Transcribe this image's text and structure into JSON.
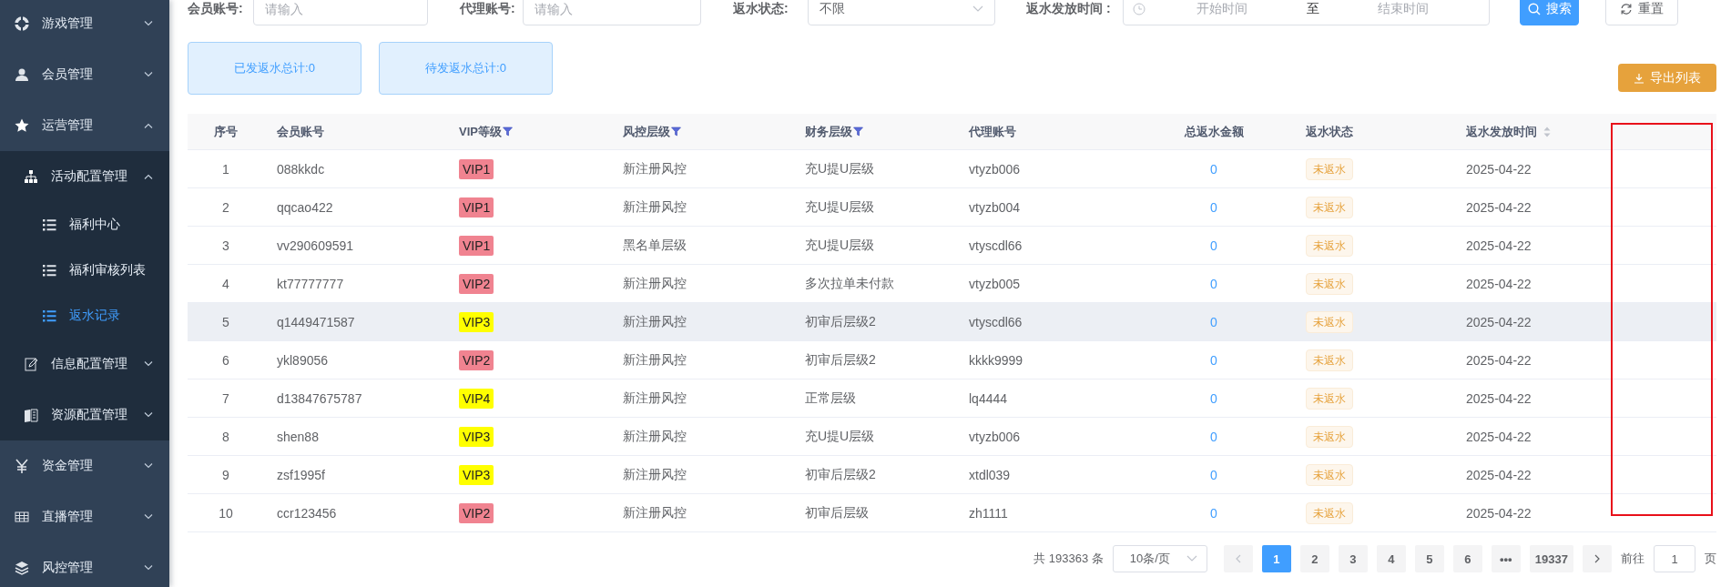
{
  "sidebar": {
    "items": [
      {
        "label": "游戏管理",
        "expanded": false,
        "selected": false
      },
      {
        "label": "会员管理",
        "expanded": false,
        "selected": false
      },
      {
        "label": "运营管理",
        "expanded": true,
        "selected": false,
        "children": [
          {
            "label": "活动配置管理",
            "expanded": true,
            "selected": false,
            "children": [
              {
                "label": "福利中心",
                "selected": false
              },
              {
                "label": "福利审核列表",
                "selected": false
              },
              {
                "label": "返水记录",
                "selected": true
              }
            ]
          },
          {
            "label": "信息配置管理",
            "expanded": false,
            "selected": false
          },
          {
            "label": "资源配置管理",
            "expanded": false,
            "selected": false
          }
        ]
      },
      {
        "label": "资金管理",
        "expanded": false,
        "selected": false
      },
      {
        "label": "直播管理",
        "expanded": false,
        "selected": false
      },
      {
        "label": "风控管理",
        "expanded": false,
        "selected": false
      }
    ]
  },
  "filters": [
    {
      "kind": "input",
      "label": "会员账号:",
      "placeholder": "请输入"
    },
    {
      "kind": "input",
      "label": "代理账号:",
      "placeholder": "请输入"
    },
    {
      "kind": "select",
      "label": "返水状态:",
      "value": "不限"
    },
    {
      "kind": "daterange",
      "label": "返水发放时间 :",
      "start_placeholder": "开始时间",
      "separator": "至",
      "end_placeholder": "结束时间"
    }
  ],
  "search_button": "搜索",
  "reset_button": "重置",
  "summary_cards": [
    "已发返水总计:0",
    "待发返水总计:0"
  ],
  "export_button": "导出列表",
  "table": {
    "columns": [
      {
        "label": "序号",
        "kind": "plain"
      },
      {
        "label": "会员账号",
        "kind": "plain"
      },
      {
        "label": "VIP等级",
        "kind": "filter"
      },
      {
        "label": "风控层级",
        "kind": "filter"
      },
      {
        "label": "财务层级",
        "kind": "filter"
      },
      {
        "label": "代理账号",
        "kind": "plain"
      },
      {
        "label": "总返水金额",
        "kind": "plain"
      },
      {
        "label": "返水状态",
        "kind": "plain"
      },
      {
        "label": "返水发放时间",
        "kind": "sortable"
      }
    ],
    "rows": [
      {
        "index": "1",
        "account": "088kkdc",
        "vip": {
          "label": "VIP1",
          "color": "#f08390"
        },
        "risk": "新注册风控",
        "finance": "充U提U层级",
        "agent": "vtyzb006",
        "total": "0",
        "status": "未返水",
        "time": "2025-04-22",
        "hovered": false
      },
      {
        "index": "2",
        "account": "qqcao422",
        "vip": {
          "label": "VIP1",
          "color": "#f08390"
        },
        "risk": "新注册风控",
        "finance": "充U提U层级",
        "agent": "vtyzb004",
        "total": "0",
        "status": "未返水",
        "time": "2025-04-22",
        "hovered": false
      },
      {
        "index": "3",
        "account": "vv290609591",
        "vip": {
          "label": "VIP1",
          "color": "#f08390"
        },
        "risk": "黑名单层级",
        "finance": "充U提U层级",
        "agent": "vtyscdl66",
        "total": "0",
        "status": "未返水",
        "time": "2025-04-22",
        "hovered": false
      },
      {
        "index": "4",
        "account": "kt77777777",
        "vip": {
          "label": "VIP2",
          "color": "#f08390"
        },
        "risk": "新注册风控",
        "finance": "多次拉单未付款",
        "agent": "vtyzb005",
        "total": "0",
        "status": "未返水",
        "time": "2025-04-22",
        "hovered": false
      },
      {
        "index": "5",
        "account": "q1449471587",
        "vip": {
          "label": "VIP3",
          "color": "#ffff00"
        },
        "risk": "新注册风控",
        "finance": "初审后层级2",
        "agent": "vtyscdl66",
        "total": "0",
        "status": "未返水",
        "time": "2025-04-22",
        "hovered": true
      },
      {
        "index": "6",
        "account": "ykl89056",
        "vip": {
          "label": "VIP2",
          "color": "#f08390"
        },
        "risk": "新注册风控",
        "finance": "初审后层级2",
        "agent": "kkkk9999",
        "total": "0",
        "status": "未返水",
        "time": "2025-04-22",
        "hovered": false
      },
      {
        "index": "7",
        "account": "d13847675787",
        "vip": {
          "label": "VIP4",
          "color": "#ffff00"
        },
        "risk": "新注册风控",
        "finance": "正常层级",
        "agent": "lq4444",
        "total": "0",
        "status": "未返水",
        "time": "2025-04-22",
        "hovered": false
      },
      {
        "index": "8",
        "account": "shen88",
        "vip": {
          "label": "VIP3",
          "color": "#ffff00"
        },
        "risk": "新注册风控",
        "finance": "充U提U层级",
        "agent": "vtyzb006",
        "total": "0",
        "status": "未返水",
        "time": "2025-04-22",
        "hovered": false
      },
      {
        "index": "9",
        "account": "zsf1995f",
        "vip": {
          "label": "VIP3",
          "color": "#ffff00"
        },
        "risk": "新注册风控",
        "finance": "初审后层级2",
        "agent": "xtdl039",
        "total": "0",
        "status": "未返水",
        "time": "2025-04-22",
        "hovered": false
      },
      {
        "index": "10",
        "account": "ccr123456",
        "vip": {
          "label": "VIP2",
          "color": "#f08390"
        },
        "risk": "新注册风控",
        "finance": "初审后层级",
        "agent": "zh1111",
        "total": "0",
        "status": "未返水",
        "time": "2025-04-22",
        "hovered": false
      }
    ]
  },
  "annotation": {
    "kind": "rectangle"
  },
  "pagination": {
    "total": "共 193363 条",
    "page_size": "10条/页",
    "pages": [
      {
        "label": "1",
        "selected": true
      },
      {
        "label": "2",
        "selected": false
      },
      {
        "label": "3",
        "selected": false
      },
      {
        "label": "4",
        "selected": false
      },
      {
        "label": "5",
        "selected": false
      },
      {
        "label": "6",
        "selected": false
      },
      {
        "label": "•••",
        "selected": false
      },
      {
        "label": "19337",
        "selected": false
      }
    ],
    "goto_label": "前往",
    "goto_value": "1",
    "goto_suffix": "页"
  }
}
